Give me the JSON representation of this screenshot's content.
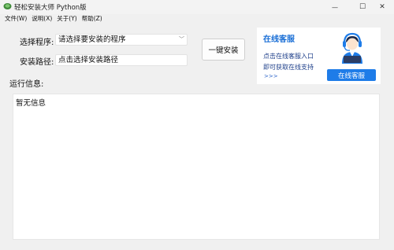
{
  "window": {
    "title": "轻松安装大师 Python版",
    "minimize_glyph": "—",
    "maximize_glyph": "☐",
    "close_glyph": "✕"
  },
  "menu": [
    {
      "label": "文件(W)"
    },
    {
      "label": "说明(X)"
    },
    {
      "label": "关于(Y)"
    },
    {
      "label": "帮助(Z)"
    }
  ],
  "form": {
    "program_label": "选择程序:",
    "program_value": "请选择要安装的程序",
    "path_label": "安装路径:",
    "path_value": "点击选择安装路径",
    "install_button": "一键安装"
  },
  "service": {
    "title": "在线客服",
    "line1": "点击在线客服入口",
    "line2": "即可获取在线支持",
    "more": ">>>",
    "button": "在线客服",
    "accent": "#1e7ce8"
  },
  "log": {
    "label": "运行信息:",
    "content": "暂无信息"
  }
}
